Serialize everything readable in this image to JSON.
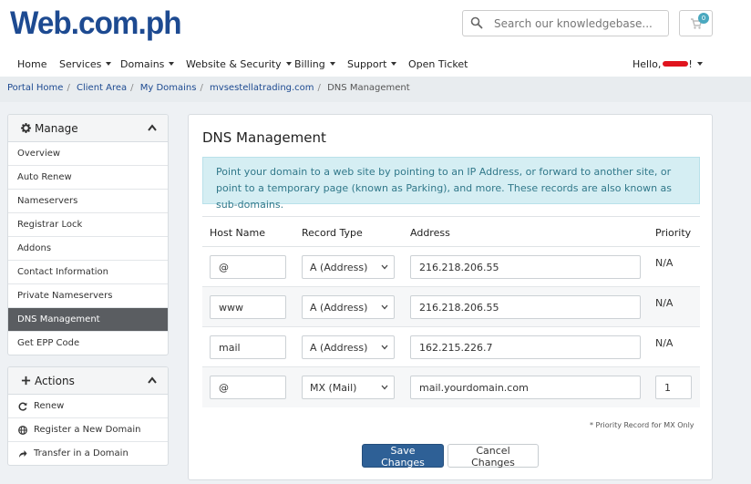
{
  "brand": {
    "logo": "Web.com.ph"
  },
  "search": {
    "placeholder": "Search our knowledgebase..."
  },
  "cart": {
    "count": "0"
  },
  "nav": {
    "items": [
      {
        "label": "Home"
      },
      {
        "label": "Services"
      },
      {
        "label": "Domains"
      },
      {
        "label": "Website & Security"
      },
      {
        "label": "Billing"
      },
      {
        "label": "Support"
      },
      {
        "label": "Open Ticket"
      }
    ],
    "greeting": "Hello,",
    "greeting_suffix": "!"
  },
  "breadcrumb": {
    "items": [
      "Portal Home",
      "Client Area",
      "My Domains",
      "mvsestellatrading.com"
    ],
    "current": "DNS Management",
    "separator": "/"
  },
  "sidebar": {
    "manage": {
      "title": "Manage",
      "items": [
        {
          "label": "Overview"
        },
        {
          "label": "Auto Renew"
        },
        {
          "label": "Nameservers"
        },
        {
          "label": "Registrar Lock"
        },
        {
          "label": "Addons"
        },
        {
          "label": "Contact Information"
        },
        {
          "label": "Private Nameservers"
        },
        {
          "label": "DNS Management",
          "active": true
        },
        {
          "label": "Get EPP Code"
        }
      ]
    },
    "actions": {
      "title": "Actions",
      "items": [
        {
          "label": "Renew",
          "icon": "refresh-icon"
        },
        {
          "label": "Register a New Domain",
          "icon": "globe-icon"
        },
        {
          "label": "Transfer in a Domain",
          "icon": "share-icon"
        }
      ]
    }
  },
  "main": {
    "title": "DNS Management",
    "info_text": "Point your domain to a web site by pointing to an IP Address, or forward to another site, or point to a temporary page (known as Parking), and more. These records are also known as sub-domains.",
    "columns": [
      "Host Name",
      "Record Type",
      "Address",
      "Priority"
    ],
    "records": [
      {
        "host": "@",
        "type": "A (Address)",
        "address": "216.218.206.55",
        "priority": "N/A"
      },
      {
        "host": "www",
        "type": "A (Address)",
        "address": "216.218.206.55",
        "priority": "N/A"
      },
      {
        "host": "mail",
        "type": "A (Address)",
        "address": "162.215.226.7",
        "priority": "N/A"
      },
      {
        "host": "@",
        "type": "MX (Mail)",
        "address": "mail.yourdomain.com",
        "priority": "1"
      }
    ],
    "footnote": "* Priority Record for MX Only",
    "save_label": "Save Changes",
    "cancel_label": "Cancel Changes"
  },
  "colors": {
    "brand": "#1d4a91",
    "active_menu": "#5a5d61",
    "info_bg": "#d5eef3",
    "primary_button": "#2e6096",
    "cart_badge": "#4aa8bf"
  }
}
